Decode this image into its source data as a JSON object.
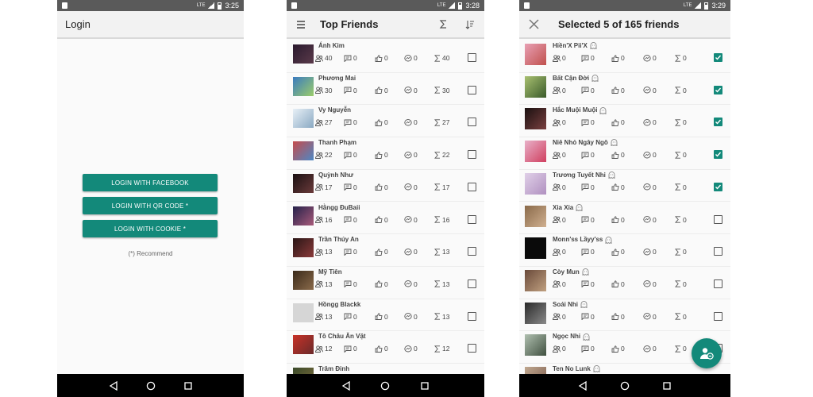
{
  "colors": {
    "accent": "#13897a",
    "status_bar": "#5a5a5a",
    "nav_bar": "#000000"
  },
  "login_screen": {
    "status_time": "3:25",
    "title": "Login",
    "buttons": [
      "LOGIN WITH FACEBOOK",
      "LOGIN WITH QR CODE *",
      "LOGIN WITH COOKIE *"
    ],
    "recommend_note": "(*) Recommend"
  },
  "top_friends_screen": {
    "status_time": "3:28",
    "title": "Top Friends",
    "icons": [
      "menu-icon",
      "sigma-icon",
      "sort-icon"
    ],
    "friends": [
      {
        "name": "Ánh Kim",
        "friends": "40",
        "comments": "0",
        "likes": "0",
        "messages": "0",
        "total": "40",
        "checked": false
      },
      {
        "name": "Phương Mai",
        "friends": "30",
        "comments": "0",
        "likes": "0",
        "messages": "0",
        "total": "30",
        "checked": false
      },
      {
        "name": "Vy Nguyễn",
        "friends": "27",
        "comments": "0",
        "likes": "0",
        "messages": "0",
        "total": "27",
        "checked": false
      },
      {
        "name": "Thanh Phạm",
        "friends": "22",
        "comments": "0",
        "likes": "0",
        "messages": "0",
        "total": "22",
        "checked": false
      },
      {
        "name": "Quỳnh Như",
        "friends": "17",
        "comments": "0",
        "likes": "0",
        "messages": "0",
        "total": "17",
        "checked": false
      },
      {
        "name": "Hằngg ĐuBaii",
        "friends": "16",
        "comments": "0",
        "likes": "0",
        "messages": "0",
        "total": "16",
        "checked": false
      },
      {
        "name": "Trần Thúy An",
        "friends": "13",
        "comments": "0",
        "likes": "0",
        "messages": "0",
        "total": "13",
        "checked": false
      },
      {
        "name": "Mỹ Tiên",
        "friends": "13",
        "comments": "0",
        "likes": "0",
        "messages": "0",
        "total": "13",
        "checked": false
      },
      {
        "name": "Hồngg Blackk",
        "friends": "13",
        "comments": "0",
        "likes": "0",
        "messages": "0",
        "total": "13",
        "checked": false
      },
      {
        "name": "Tô Châu Ăn Vặt",
        "friends": "12",
        "comments": "0",
        "likes": "0",
        "messages": "0",
        "total": "12",
        "checked": false
      },
      {
        "name": "Trâm Đinh",
        "friends": "",
        "comments": "",
        "likes": "",
        "messages": "",
        "total": "",
        "checked": false
      }
    ]
  },
  "selected_screen": {
    "status_time": "3:29",
    "title": "Selected 5 of 165 friends",
    "friends": [
      {
        "name": "Hiền'X Pii'X",
        "friends": "0",
        "comments": "0",
        "likes": "0",
        "messages": "0",
        "total": "0",
        "checked": true
      },
      {
        "name": "Bất Cận Đời",
        "friends": "0",
        "comments": "0",
        "likes": "0",
        "messages": "0",
        "total": "0",
        "checked": true
      },
      {
        "name": "Hắc Muội Muội",
        "friends": "0",
        "comments": "0",
        "likes": "0",
        "messages": "0",
        "total": "0",
        "checked": true
      },
      {
        "name": "Niê Nhỏ Ngây Ngô",
        "friends": "0",
        "comments": "0",
        "likes": "0",
        "messages": "0",
        "total": "0",
        "checked": true
      },
      {
        "name": "Trương Tuyết Nhi",
        "friends": "0",
        "comments": "0",
        "likes": "0",
        "messages": "0",
        "total": "0",
        "checked": true
      },
      {
        "name": "Xia Xia",
        "friends": "0",
        "comments": "0",
        "likes": "0",
        "messages": "0",
        "total": "0",
        "checked": false
      },
      {
        "name": "Monn'ss Lầyy'ss",
        "friends": "0",
        "comments": "0",
        "likes": "0",
        "messages": "0",
        "total": "0",
        "checked": false
      },
      {
        "name": "Còy Mun",
        "friends": "0",
        "comments": "0",
        "likes": "0",
        "messages": "0",
        "total": "0",
        "checked": false
      },
      {
        "name": "Soái Nhi",
        "friends": "0",
        "comments": "0",
        "likes": "0",
        "messages": "0",
        "total": "0",
        "checked": false
      },
      {
        "name": "Ngọc Nhi",
        "friends": "0",
        "comments": "0",
        "likes": "0",
        "messages": "0",
        "total": "0",
        "checked": false
      },
      {
        "name": "Ten No Lunk",
        "friends": "",
        "comments": "",
        "likes": "",
        "messages": "",
        "total": "",
        "checked": false
      }
    ]
  }
}
